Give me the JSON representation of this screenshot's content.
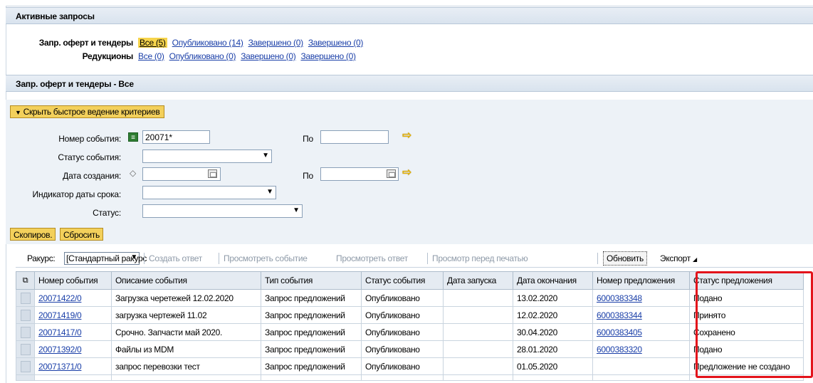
{
  "active_requests": {
    "title": "Активные запросы",
    "rows": [
      {
        "label": "Запр. оферт и тендеры",
        "links": [
          "Все (5)",
          "Опубликовано (14)",
          "Завершено (0)",
          "Завершено (0)"
        ],
        "selected_index": 0
      },
      {
        "label": "Редукционы",
        "links": [
          "Все (0)",
          "Опубликовано (0)",
          "Завершено (0)",
          "Завершено (0)"
        ],
        "selected_index": -1
      }
    ]
  },
  "list": {
    "title": "Запр. оферт и тендеры - Все",
    "toggle_label": "Скрыть быстрое ведение критериев"
  },
  "criteria": {
    "event_number_label": "Номер события:",
    "event_number_value": "20071*",
    "include_icon": "include-icon",
    "to_label": "По",
    "event_status_label": "Статус события:",
    "create_date_label": "Дата создания:",
    "deadline_indicator_label": "Индикатор даты срока:",
    "status_label": "Статус:",
    "copy_button": "Скопиров.",
    "reset_button": "Сбросить"
  },
  "toolbar": {
    "view_label": "Ракурс:",
    "view_value": "[Стандартный ракурс",
    "create_response": "Создать ответ",
    "view_event": "Просмотреть событие",
    "view_response": "Просмотреть ответ",
    "print_preview": "Просмотр перед печатью",
    "refresh": "Обновить",
    "export": "Экспорт"
  },
  "table": {
    "columns": [
      "Номер события",
      "Описание события",
      "Тип события",
      "Статус события",
      "Дата запуска",
      "Дата окончания",
      "Номер предложения",
      "Статус предложения"
    ],
    "rows": [
      [
        "20071422/0",
        "Загрузка черетежей 12.02.2020",
        "Запрос предложений",
        "Опубликовано",
        "",
        "13.02.2020",
        "6000383348",
        "Подано"
      ],
      [
        "20071419/0",
        "загрузка чертежей 11.02",
        "Запрос предложений",
        "Опубликовано",
        "",
        "12.02.2020",
        "6000383344",
        "Принято"
      ],
      [
        "20071417/0",
        "Срочно. Запчасти май 2020.",
        "Запрос предложений",
        "Опубликовано",
        "",
        "30.04.2020",
        "6000383405",
        "Сохранено"
      ],
      [
        "20071392/0",
        "Файлы из MDM",
        "Запрос предложений",
        "Опубликовано",
        "",
        "28.01.2020",
        "6000383320",
        "Подано"
      ],
      [
        "20071371/0",
        "запрос перевозки тест",
        "Запрос предложений",
        "Опубликовано",
        "",
        "01.05.2020",
        "",
        "Предложение не создано"
      ]
    ]
  },
  "colors": {
    "highlight": "#e3131b",
    "selected_link": "#f6d44c",
    "link": "#1a3fa8"
  }
}
